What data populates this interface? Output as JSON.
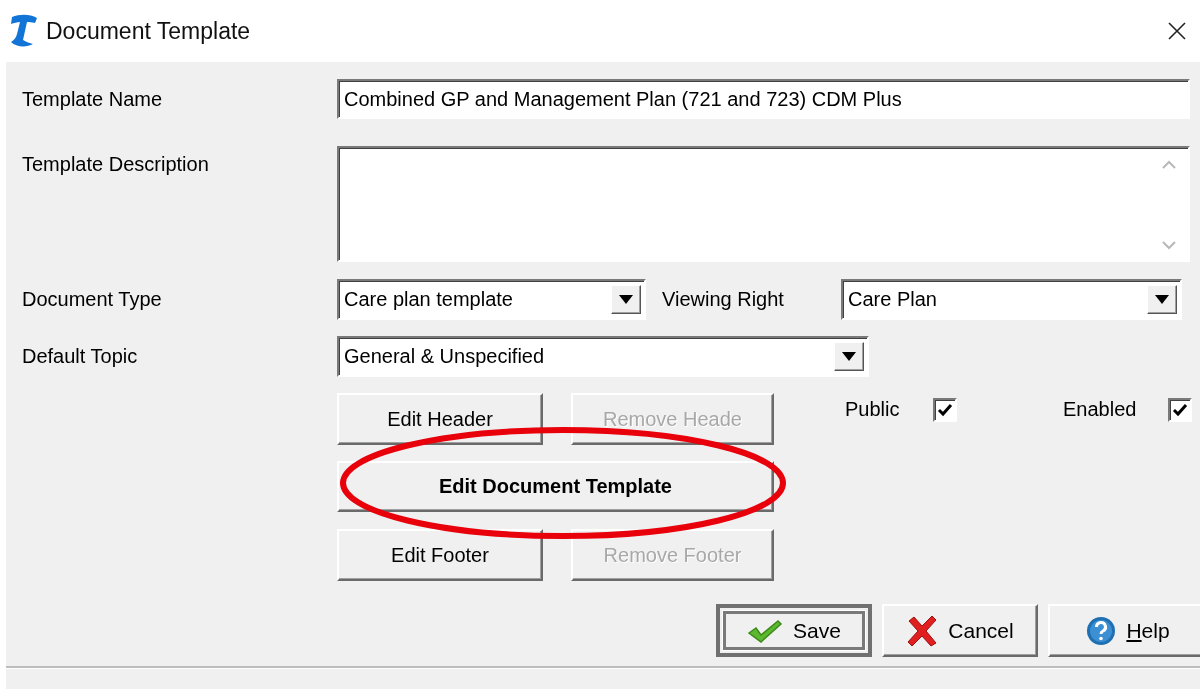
{
  "window": {
    "title": "Document Template"
  },
  "template_name": {
    "label": "Template Name",
    "value": "Combined GP and Management Plan (721 and 723) CDM Plus"
  },
  "template_description": {
    "label": "Template Description"
  },
  "document_type": {
    "label": "Document Type",
    "value": "Care plan template"
  },
  "viewing_right": {
    "label": "Viewing Right",
    "value": "Care Plan"
  },
  "default_topic": {
    "label": "Default Topic",
    "value": "General & Unspecified"
  },
  "button_rows": [
    {
      "buttons": [
        {
          "label": "Edit Header",
          "kind": "normal",
          "disabled": false,
          "circled": false
        },
        {
          "label": "Remove Heade",
          "kind": "normal",
          "disabled": true,
          "circled": false
        }
      ]
    },
    {
      "buttons": [
        {
          "label": "Edit Document Template",
          "kind": "wide",
          "disabled": false,
          "circled": true
        }
      ]
    },
    {
      "buttons": [
        {
          "label": "Edit Footer",
          "kind": "normal",
          "disabled": false,
          "circled": false
        },
        {
          "label": "Remove Footer",
          "kind": "normal",
          "disabled": true,
          "circled": false
        }
      ]
    }
  ],
  "checkboxes": [
    {
      "label": "Public",
      "checked": true
    },
    {
      "label": "Enabled",
      "checked": true
    }
  ],
  "dialog_buttons": [
    {
      "label": "Save",
      "kind": "check",
      "default": true,
      "underline_first": false
    },
    {
      "label": "Cancel",
      "kind": "cross",
      "default": false,
      "underline_first": false
    },
    {
      "label": "Help",
      "kind": "help",
      "default": false,
      "underline_first": true
    }
  ]
}
